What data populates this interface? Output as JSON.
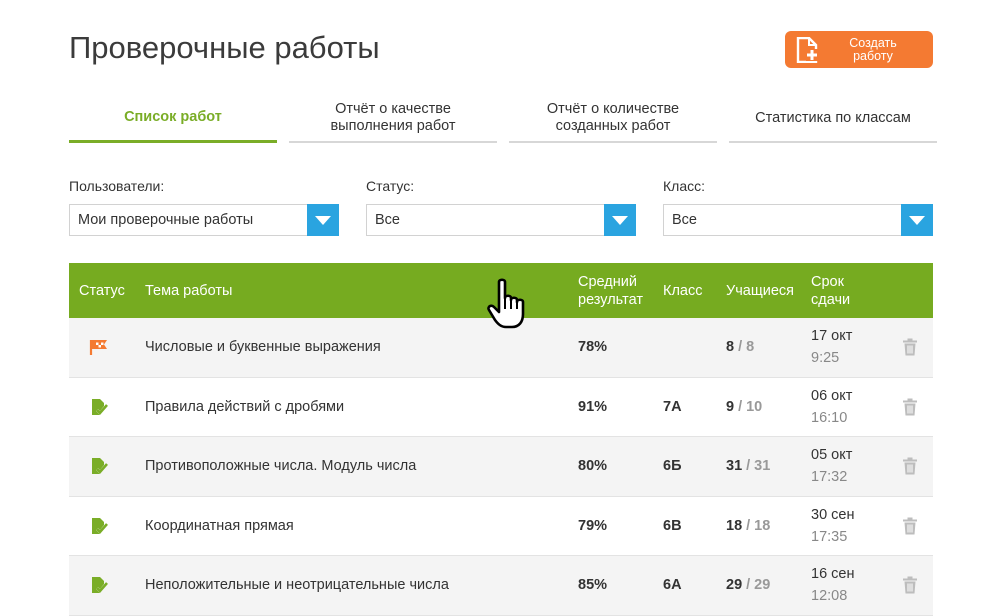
{
  "page": {
    "title": "Проверочные работы"
  },
  "create_button": {
    "label": "Создать\nработу",
    "icon": "document-plus-icon"
  },
  "tabs": [
    {
      "label": "Список работ",
      "active": true
    },
    {
      "label": "Отчёт о качестве\nвыполнения работ",
      "active": false
    },
    {
      "label": "Отчёт о количестве\nсозданных работ",
      "active": false
    },
    {
      "label": "Статистика по классам",
      "active": false
    }
  ],
  "filters": {
    "users": {
      "label": "Пользователи:",
      "value": "Мои проверочные работы"
    },
    "status": {
      "label": "Статус:",
      "value": "Все"
    },
    "class": {
      "label": "Класс:",
      "value": "Все"
    }
  },
  "table": {
    "headers": {
      "status": "Статус",
      "topic": "Тема работы",
      "avg": "Средний\nрезультат",
      "class": "Класс",
      "students": "Учащиеся",
      "due": "Срок\nсдачи"
    },
    "rows": [
      {
        "status_icon": "flag-icon",
        "topic": "Числовые и буквенные выражения",
        "avg": "78%",
        "class": "",
        "done": "8",
        "sep": "/",
        "total": "8",
        "date": "17 окт",
        "time": "9:25"
      },
      {
        "status_icon": "check-document-icon",
        "topic": "Правила действий с дробями",
        "avg": "91%",
        "class": "7А",
        "done": "9",
        "sep": "/",
        "total": "10",
        "date": "06 окт",
        "time": "16:10"
      },
      {
        "status_icon": "check-document-icon",
        "topic": "Противоположные числа. Модуль числа",
        "avg": "80%",
        "class": "6Б",
        "done": "31",
        "sep": "/",
        "total": "31",
        "date": "05 окт",
        "time": "17:32"
      },
      {
        "status_icon": "check-document-icon",
        "topic": "Координатная прямая",
        "avg": "79%",
        "class": "6В",
        "done": "18",
        "sep": "/",
        "total": "18",
        "date": "30 сен",
        "time": "17:35"
      },
      {
        "status_icon": "check-document-icon",
        "topic": "Неположительные и неотрицательные числа",
        "avg": "85%",
        "class": "6А",
        "done": "29",
        "sep": "/",
        "total": "29",
        "date": "16 сен",
        "time": "12:08"
      }
    ]
  },
  "colors": {
    "accent_green": "#76ab20",
    "orange": "#f47a32",
    "select_blue": "#2aa4e0"
  }
}
